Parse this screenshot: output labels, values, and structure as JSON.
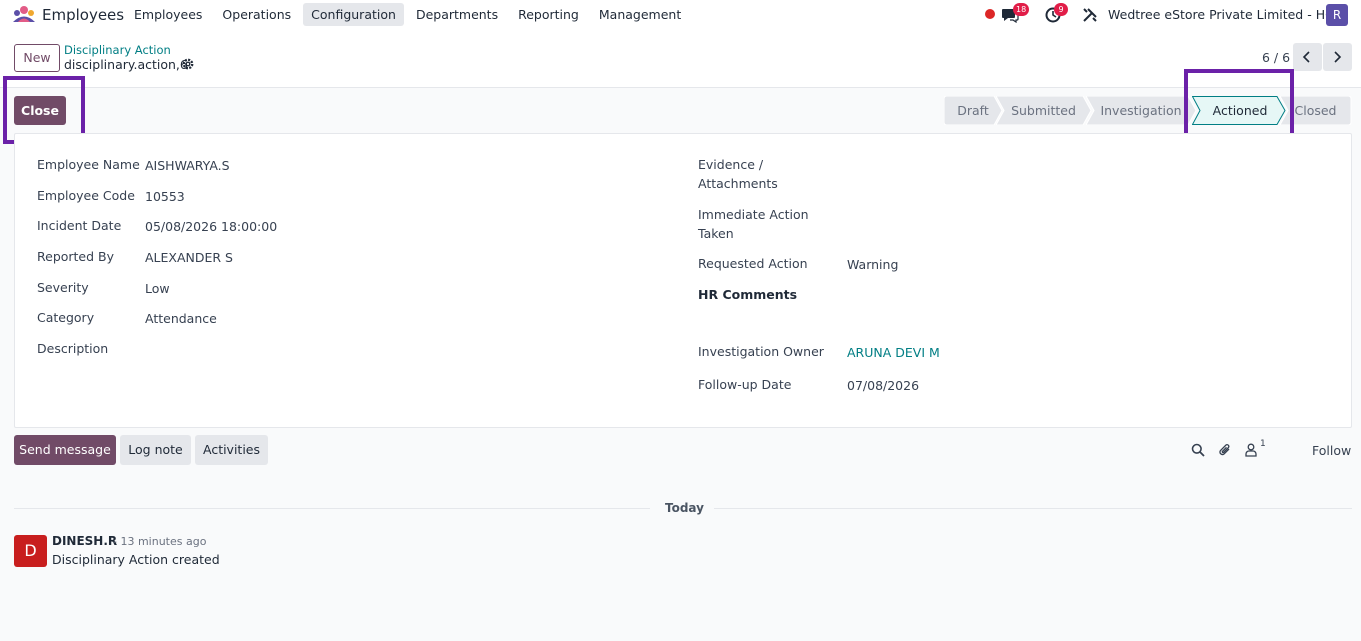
{
  "navbar": {
    "app_name": "Employees",
    "menu": [
      "Employees",
      "Operations",
      "Configuration",
      "Departments",
      "Reporting",
      "Management"
    ],
    "active_menu": "Configuration",
    "message_count": "18",
    "activity_count": "9",
    "company": "Wedtree eStore Private Limited - HO",
    "user_initial": "R",
    "user_avatar_color": "#5b4fa8"
  },
  "control_panel": {
    "new_label": "New",
    "breadcrumb_parent": "Disciplinary Action",
    "breadcrumb_current": "disciplinary.action,6",
    "pager": "6 / 6"
  },
  "actions": {
    "close_label": "Close"
  },
  "statusbar": {
    "stages": [
      "Draft",
      "Submitted",
      "Investigation",
      "Actioned",
      "Closed"
    ],
    "current": "Actioned"
  },
  "form": {
    "left": [
      {
        "label": "Employee Name",
        "value": "AISHWARYA.S"
      },
      {
        "label": "Employee Code",
        "value": "10553"
      },
      {
        "label": "Incident Date",
        "value": "05/08/2026 18:00:00"
      },
      {
        "label": "Reported By",
        "value": "ALEXANDER S"
      },
      {
        "label": "Severity",
        "value": "Low"
      },
      {
        "label": "Category",
        "value": "Attendance"
      },
      {
        "label": "Description",
        "value": ""
      }
    ],
    "right": {
      "evidence_label": "Evidence / Attachments",
      "immediate_label": "Immediate Action Taken",
      "requested_label": "Requested Action",
      "requested_value": "Warning",
      "hr_comments_label": "HR Comments",
      "owner_label": "Investigation Owner",
      "owner_value": "ARUNA DEVI M",
      "followup_label": "Follow-up Date",
      "followup_value": "07/08/2026"
    }
  },
  "chatter": {
    "send_message": "Send message",
    "log_note": "Log note",
    "activities": "Activities",
    "followers": "1",
    "follow": "Follow",
    "date_separator": "Today",
    "messages": [
      {
        "initial": "D",
        "author": "DINESH.R",
        "time": "- 13 minutes ago",
        "body": "Disciplinary Action created"
      }
    ]
  },
  "colors": {
    "primary": "#714b67",
    "link": "#017e84",
    "highlight": "#6b21a8"
  }
}
